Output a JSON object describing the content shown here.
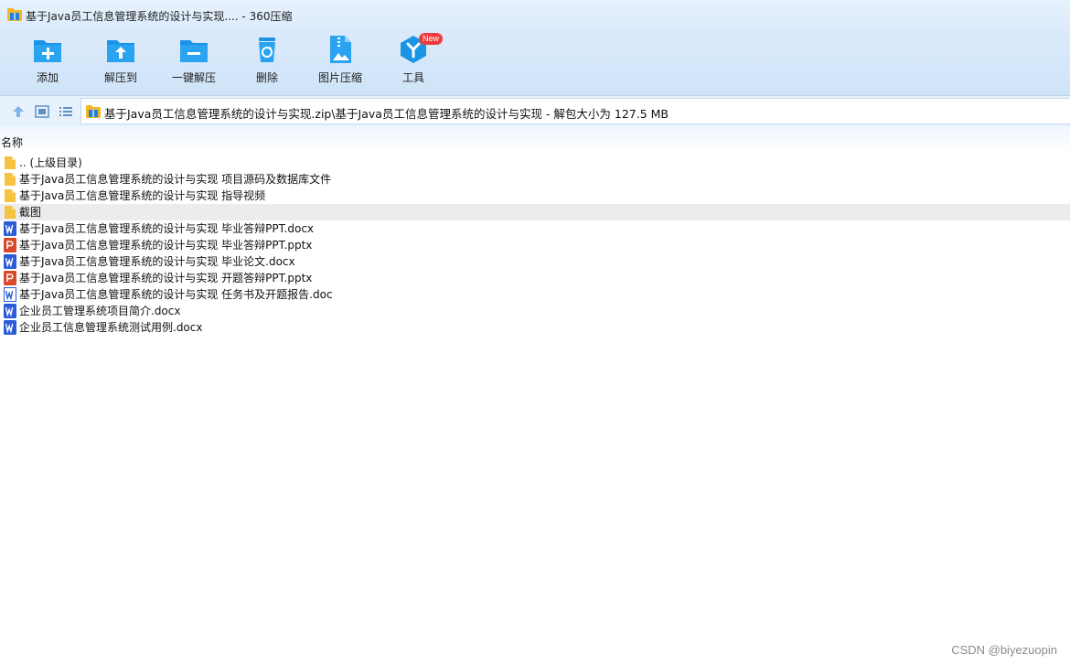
{
  "window": {
    "title": "基于Java员工信息管理系统的设计与实现.... - 360压缩",
    "app_icon": "archive-icon"
  },
  "toolbar": {
    "buttons": [
      {
        "label": "添加",
        "icon": "add-folder-icon"
      },
      {
        "label": "解压到",
        "icon": "extract-to-icon"
      },
      {
        "label": "一键解压",
        "icon": "one-click-extract-icon"
      },
      {
        "label": "删除",
        "icon": "recycle-bin-icon"
      },
      {
        "label": "图片压缩",
        "icon": "image-compress-icon"
      },
      {
        "label": "工具",
        "icon": "tools-icon",
        "badge": "New"
      }
    ]
  },
  "nav": {
    "up_icon": "arrow-up-icon",
    "view_icon": "view-thumbnail-icon",
    "list_icon": "view-list-icon",
    "path": "基于Java员工信息管理系统的设计与实现.zip\\基于Java员工信息管理系统的设计与实现 - 解包大小为 127.5 MB"
  },
  "list": {
    "column_name": "名称",
    "items": [
      {
        "name": ".. (上级目录)",
        "type": "folder"
      },
      {
        "name": "基于Java员工信息管理系统的设计与实现 项目源码及数据库文件",
        "type": "folder"
      },
      {
        "name": "基于Java员工信息管理系统的设计与实现 指导视频",
        "type": "folder"
      },
      {
        "name": "截图",
        "type": "folder",
        "selected": true
      },
      {
        "name": "基于Java员工信息管理系统的设计与实现 毕业答辩PPT.docx",
        "type": "word"
      },
      {
        "name": "基于Java员工信息管理系统的设计与实现 毕业答辩PPT.pptx",
        "type": "ppt"
      },
      {
        "name": "基于Java员工信息管理系统的设计与实现 毕业论文.docx",
        "type": "word"
      },
      {
        "name": "基于Java员工信息管理系统的设计与实现 开题答辩PPT.pptx",
        "type": "ppt"
      },
      {
        "name": "基于Java员工信息管理系统的设计与实现 任务书及开题报告.doc",
        "type": "word-doc"
      },
      {
        "name": "企业员工管理系统项目简介.docx",
        "type": "word"
      },
      {
        "name": "企业员工信息管理系统测试用例.docx",
        "type": "word"
      }
    ]
  },
  "watermark": "CSDN @biyezuopin",
  "colors": {
    "accent": "#1a94e6",
    "folder": "#f5c242",
    "word": "#2b5cd6",
    "ppt": "#d84a2b",
    "badge": "#ef3b3b"
  }
}
